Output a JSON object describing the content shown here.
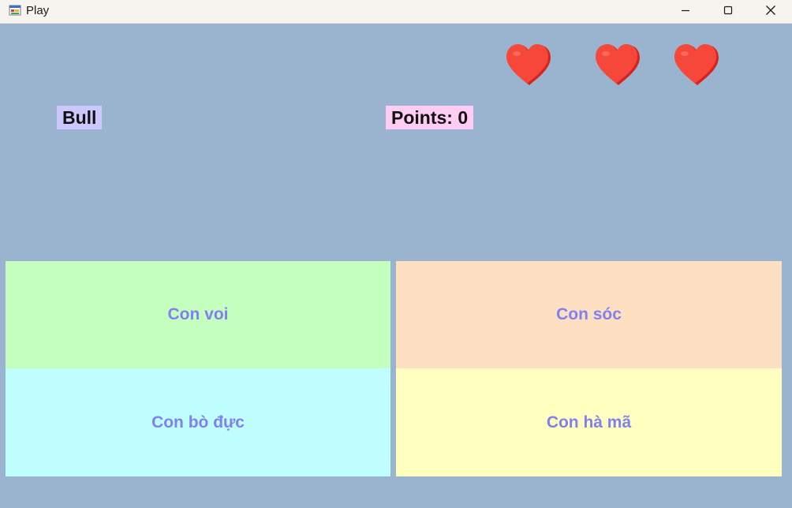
{
  "window": {
    "title": "Play",
    "app_icon": "windows-form-icon",
    "controls": [
      "minimize-icon",
      "maximize-icon",
      "close-icon"
    ]
  },
  "game": {
    "word": "Bull",
    "points_label": "Points: 0",
    "points": 0,
    "lives": 3,
    "life_icon": "heart-icon",
    "answers": [
      {
        "label": "Con voi",
        "color": "#C4FFC0"
      },
      {
        "label": "Con sóc",
        "color": "#FFDFC2"
      },
      {
        "label": "Con bò đực",
        "color": "#C0FFFF"
      },
      {
        "label": "Con hà mã",
        "color": "#FFFFC0"
      }
    ]
  },
  "colors": {
    "background": "#9AB4D0",
    "word_label_bg": "#CCC8FF",
    "points_label_bg": "#FFCCF4",
    "answer_text": "#8080F0",
    "heart": "#F5483A"
  }
}
